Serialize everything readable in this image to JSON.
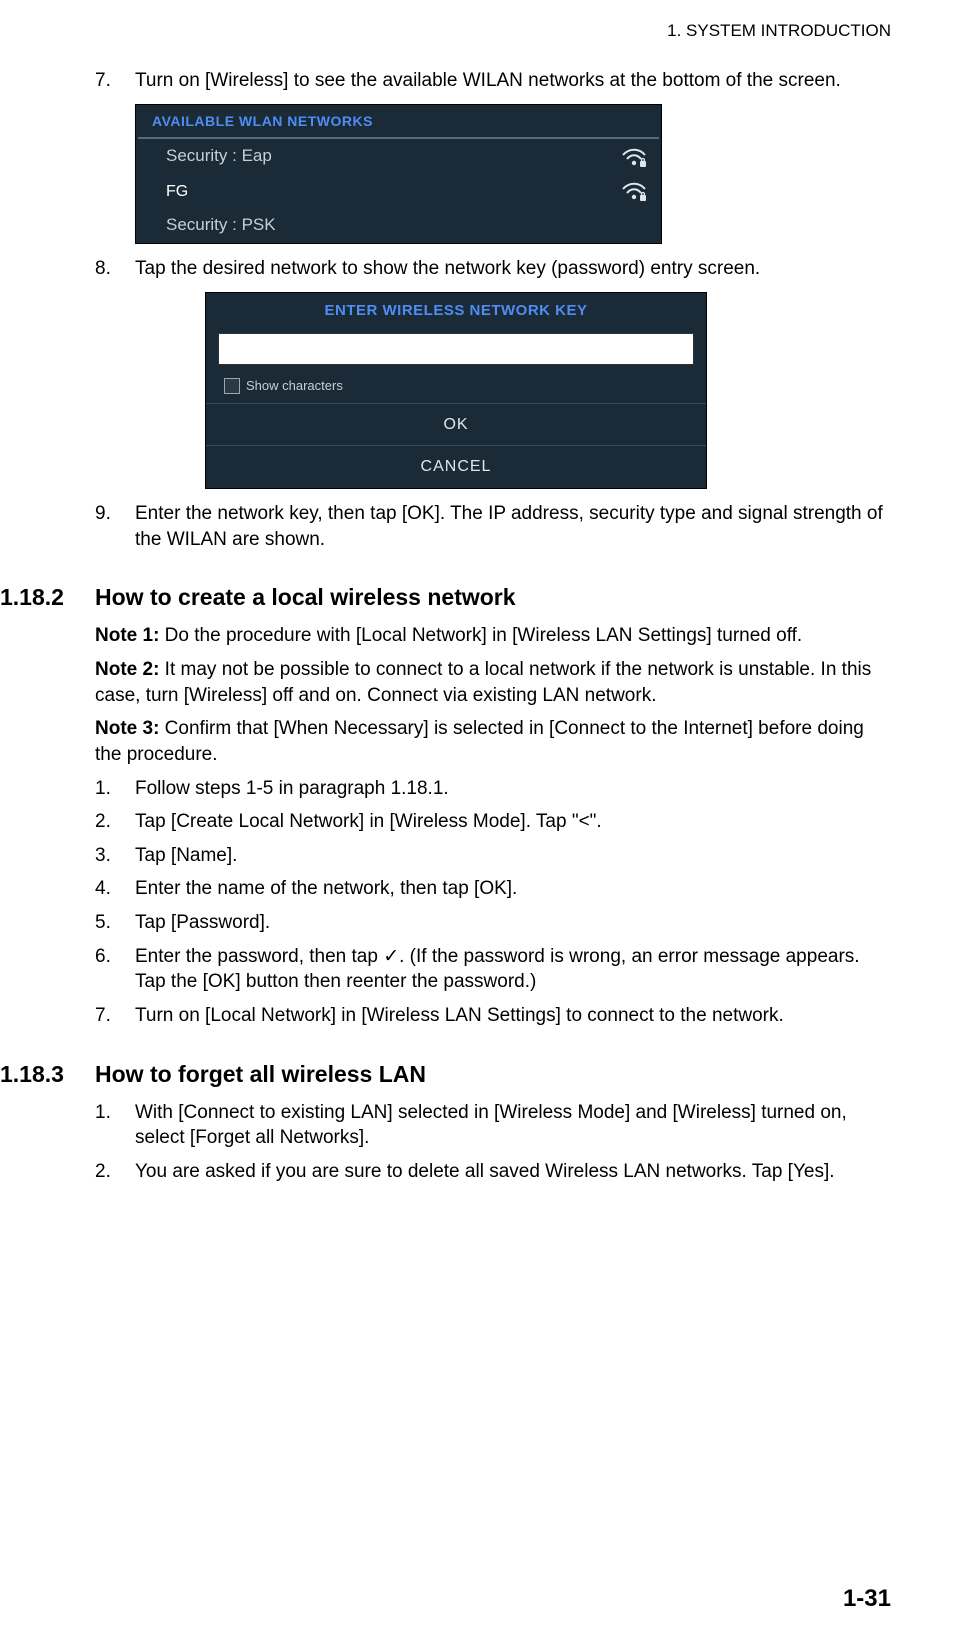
{
  "header": {
    "chapter": "1.  SYSTEM INTRODUCTION"
  },
  "steps_top": [
    {
      "num": "7.",
      "text": "Turn on [Wireless] to see the available WILAN networks at the bottom of the screen."
    },
    {
      "num": "8.",
      "text": "Tap the desired network to show the network key (password) entry screen."
    },
    {
      "num": "9.",
      "text": "Enter the network key, then tap [OK]. The IP address, security type and signal strength of the WILAN are shown."
    }
  ],
  "shot1": {
    "title": "AVAILABLE WLAN NETWORKS",
    "rows": [
      {
        "label": "Security : Eap"
      },
      {
        "label": "FG",
        "fg": true
      },
      {
        "label": "Security : PSK"
      }
    ]
  },
  "shot2": {
    "title": "ENTER WIRELESS NETWORK KEY",
    "show_chars": "Show characters",
    "ok": "OK",
    "cancel": "CANCEL"
  },
  "sec2": {
    "num": "1.18.2",
    "title": "How to create a local wireless network",
    "note1_label": "Note 1:",
    "note1": " Do the procedure with [Local Network] in [Wireless LAN Settings] turned off.",
    "note2_label": "Note 2:",
    "note2": " It may not be possible to connect to a local network if the network is unstable. In this case, turn [Wireless] off and on. Connect via existing LAN network.",
    "note3_label": "Note 3:",
    "note3": " Confirm that [When Necessary] is selected in [Connect to the Internet] before doing the procedure.",
    "steps": [
      {
        "num": "1.",
        "text": "Follow steps 1-5 in paragraph 1.18.1."
      },
      {
        "num": "2.",
        "text": "Tap [Create Local Network] in [Wireless Mode]. Tap \"<\"."
      },
      {
        "num": "3.",
        "text": "Tap [Name]."
      },
      {
        "num": "4.",
        "text": "Enter the name of the network, then tap [OK]."
      },
      {
        "num": "5.",
        "text": "Tap [Password]."
      },
      {
        "num": "6.",
        "text": "Enter the password, then tap ✓. (If the password is wrong, an error message appears. Tap the [OK] button then reenter the password.)"
      },
      {
        "num": "7.",
        "text": "Turn on [Local Network] in [Wireless LAN Settings] to connect to the network."
      }
    ]
  },
  "sec3": {
    "num": "1.18.3",
    "title": "How to forget all wireless LAN",
    "steps": [
      {
        "num": "1.",
        "text": "With [Connect to existing LAN] selected in [Wireless Mode] and [Wireless] turned on, select [Forget all Networks]."
      },
      {
        "num": "2.",
        "text": "You are asked if you are sure to delete all saved Wireless LAN networks. Tap [Yes]."
      }
    ]
  },
  "page_num": "1-31"
}
